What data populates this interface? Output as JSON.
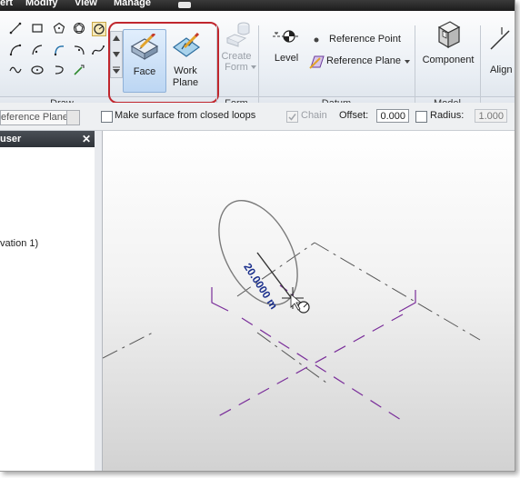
{
  "menu": {
    "items": [
      "ert",
      "Modify",
      "View",
      "Manage"
    ]
  },
  "ribbon": {
    "draw_panel_label": "Draw",
    "form_panel_label": "Form",
    "datum_panel_label": "Datum",
    "model_panel_label": "Model",
    "face_label": "Face",
    "work_plane_label_1": "Work",
    "work_plane_label_2": "Plane",
    "create_form_label_1": "Create",
    "create_form_label_2": "Form",
    "level_label": "Level",
    "reference_point_label": "Reference Point",
    "reference_plane_label": "Reference Plane",
    "component_label": "Component",
    "align_label": "Align"
  },
  "options": {
    "plane_selector_value": "eference Plane :",
    "make_surface_label": "Make surface from closed loops",
    "chain_label": "Chain",
    "offset_label": "Offset:",
    "offset_value": "0.000",
    "radius_label": "Radius:",
    "radius_value": "1.000"
  },
  "browser": {
    "title": "user",
    "item_text": "vation 1)"
  },
  "view": {
    "dimension_text": "20.0000 m"
  },
  "colors": {
    "highlight": "#c0262d",
    "ref_plane": "#7a2e9a",
    "dimension": "#1a2f8c"
  }
}
